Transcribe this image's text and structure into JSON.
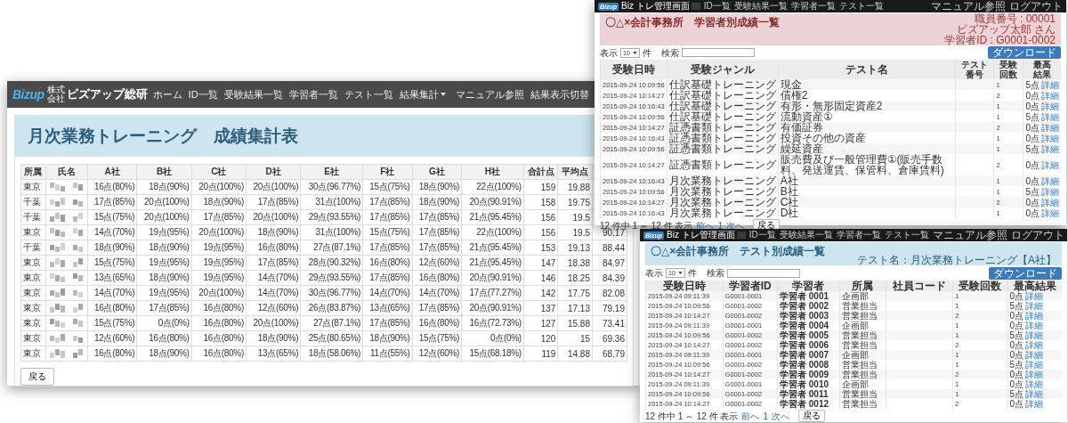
{
  "main_window": {
    "logo": "Bizup",
    "company_prefix": "株式会社",
    "company": "ビズアップ総研",
    "nav": [
      {
        "label": "ホーム",
        "dropdown": false
      },
      {
        "label": "ID一覧",
        "dropdown": false
      },
      {
        "label": "受験結果一覧",
        "dropdown": false
      },
      {
        "label": "学習者一覧",
        "dropdown": false
      },
      {
        "label": "テスト一覧",
        "dropdown": false
      },
      {
        "label": "結果集計",
        "dropdown": true
      }
    ],
    "nav_right": [
      "マニュアル参照",
      "結果表示切替"
    ],
    "title": "月次業務トレーニング　成績集計表",
    "table": {
      "columns": [
        "所属",
        "氏名",
        "A社",
        "B社",
        "C社",
        "D社",
        "E社",
        "F社",
        "G社",
        "H社",
        "合計点",
        "平均点"
      ],
      "rows": [
        {
          "dept": "東京",
          "scores": [
            "16点(80%)",
            "18点(90%)",
            "20点(100%)",
            "20点(100%)",
            "30点(96.77%)",
            "15点(75%)",
            "18点(90%)",
            "22点(100%)"
          ],
          "total": "159",
          "average": "19.88"
        },
        {
          "dept": "千葉",
          "scores": [
            "17点(85%)",
            "20点(100%)",
            "18点(90%)",
            "17点(85%)",
            "31点(100%)",
            "17点(85%)",
            "18点(90%)",
            "20点(90.91%)"
          ],
          "total": "158",
          "average": "19.75"
        },
        {
          "dept": "千葉",
          "scores": [
            "15点(75%)",
            "20点(100%)",
            "17点(85%)",
            "20点(100%)",
            "29点(93.55%)",
            "17点(85%)",
            "17点(85%)",
            "21点(95.45%)"
          ],
          "total": "156",
          "average": "19.5"
        },
        {
          "dept": "東京",
          "scores": [
            "14点(70%)",
            "19点(95%)",
            "20点(100%)",
            "18点(90%)",
            "31点(100%)",
            "15点(75%)",
            "17点(85%)",
            "22点(100%)"
          ],
          "total": "156",
          "average": "19.5",
          "rate": "90.17"
        },
        {
          "dept": "千葉",
          "scores": [
            "18点(90%)",
            "18点(90%)",
            "19点(95%)",
            "16点(80%)",
            "27点(87.1%)",
            "17点(85%)",
            "17点(85%)",
            "21点(95.45%)"
          ],
          "total": "153",
          "average": "19.13",
          "rate": "88.44"
        },
        {
          "dept": "東京",
          "scores": [
            "15点(75%)",
            "19点(95%)",
            "19点(95%)",
            "17点(85%)",
            "28点(90.32%)",
            "16点(80%)",
            "12点(60%)",
            "21点(95.45%)"
          ],
          "total": "147",
          "average": "18.38",
          "rate": "84.97"
        },
        {
          "dept": "東京",
          "scores": [
            "13点(65%)",
            "18点(90%)",
            "19点(95%)",
            "14点(70%)",
            "29点(93.55%)",
            "17点(85%)",
            "16点(80%)",
            "20点(90.91%)"
          ],
          "total": "146",
          "average": "18.25",
          "rate": "84.39"
        },
        {
          "dept": "東京",
          "scores": [
            "14点(70%)",
            "19点(95%)",
            "20点(100%)",
            "14点(70%)",
            "30点(96.77%)",
            "14点(70%)",
            "14点(70%)",
            "17点(77.27%)"
          ],
          "total": "142",
          "average": "17.75",
          "rate": "82.08"
        },
        {
          "dept": "東京",
          "scores": [
            "16点(80%)",
            "17点(85%)",
            "16点(80%)",
            "12点(60%)",
            "26点(83.87%)",
            "13点(65%)",
            "17点(85%)",
            "20点(90.91%)"
          ],
          "total": "137",
          "average": "17.13",
          "rate": "79.19"
        },
        {
          "dept": "東京",
          "scores": [
            "15点(75%)",
            "0点(0%)",
            "16点(80%)",
            "20点(100%)",
            "27点(87.1%)",
            "17点(85%)",
            "16点(80%)",
            "16点(72.73%)"
          ],
          "total": "127",
          "average": "15.88",
          "rate": "73.41"
        },
        {
          "dept": "東京",
          "scores": [
            "12点(60%)",
            "16点(80%)",
            "16点(80%)",
            "18点(90%)",
            "25点(80.65%)",
            "18点(90%)",
            "15点(75%)",
            "0点(0%)"
          ],
          "total": "120",
          "average": "15",
          "rate": "69.36"
        },
        {
          "dept": "東京",
          "scores": [
            "16点(80%)",
            "18点(90%)",
            "16点(80%)",
            "13点(65%)",
            "18点(58.06%)",
            "11点(55%)",
            "12点(60%)",
            "15点(68.18%)"
          ],
          "total": "119",
          "average": "14.88",
          "rate": "68.79"
        }
      ]
    },
    "back_button": "戻る"
  },
  "learner_window": {
    "logo": "Bizup",
    "app_title": "Biz トレ管理画面",
    "nav": [
      "ID一覧",
      "受験結果一覧",
      "学習者一覧",
      "テスト一覧"
    ],
    "nav_right": [
      "マニュアル参照",
      "ログアウト"
    ],
    "title": "〇△×会計事務所　学習者別成績一覧",
    "info": [
      "職員番号 : 00001",
      "ビズアップ太郎 さん",
      "学習者ID : G0001-0002"
    ],
    "download_button": "ダウンロード",
    "length_label": "表示",
    "length_value": "10",
    "length_unit": "件",
    "search_label": "検索",
    "columns": [
      "受験日時",
      "受験ジャンル",
      "テスト名",
      "テスト番号",
      "受験回数",
      "最高結果"
    ],
    "rows": [
      {
        "date": "2015-09-24 10:09:56",
        "genre": "仕訳基礎トレーニング",
        "test": "現金",
        "attempts": "1",
        "score": "5点",
        "link": "詳細"
      },
      {
        "date": "2015-09-24 10:14:27",
        "genre": "仕訳基礎トレーニング",
        "test": "債権2",
        "attempts": "2",
        "score": "0点",
        "link": "詳細"
      },
      {
        "date": "2015-09-24 10:16:43",
        "genre": "仕訳基礎トレーニング",
        "test": "有形・無形固定資産2",
        "attempts": "1",
        "score": "0点",
        "link": "詳細"
      },
      {
        "date": "2015-09-24 10:09:56",
        "genre": "仕訳基礎トレーニング",
        "test": "流動資産①",
        "attempts": "1",
        "score": "5点",
        "link": "詳細"
      },
      {
        "date": "2015-09-24 10:14:27",
        "genre": "証憑書類トレーニング",
        "test": "有価証券",
        "attempts": "2",
        "score": "0点",
        "link": "詳細"
      },
      {
        "date": "2015-09-24 10:16:43",
        "genre": "証憑書類トレーニング",
        "test": "投資その他の資産",
        "attempts": "1",
        "score": "0点",
        "link": "詳細"
      },
      {
        "date": "2015-09-24 10:09:56",
        "genre": "証憑書類トレーニング",
        "test": "繰延資産",
        "attempts": "1",
        "score": "5点",
        "link": "詳細"
      },
      {
        "date": "2015-09-24 10:14:27",
        "genre": "証憑書類トレーニング",
        "test": "販売費及び一般管理費①(販売手数料、発送運賃、保管料、倉庫賃料)",
        "attempts": "2",
        "score": "0点",
        "link": "詳細"
      },
      {
        "date": "2015-09-24 10:16:43",
        "genre": "月次業務トレーニング",
        "test": "A社",
        "attempts": "1",
        "score": "0点",
        "link": "詳細"
      },
      {
        "date": "2015-09-24 10:09:56",
        "genre": "月次業務トレーニング",
        "test": "B社",
        "attempts": "1",
        "score": "5点",
        "link": "詳細"
      },
      {
        "date": "2015-09-24 10:14:27",
        "genre": "月次業務トレーニング",
        "test": "C社",
        "attempts": "2",
        "score": "0点",
        "link": "詳細"
      },
      {
        "date": "2015-09-24 10:16:43",
        "genre": "月次業務トレーニング",
        "test": "D社",
        "attempts": "1",
        "score": "0点",
        "link": "詳細"
      }
    ],
    "summary": "12 件中 1 ～ 12 件 表示",
    "pager": [
      "前へ",
      "1",
      "次へ"
    ],
    "back_button": "戻る"
  },
  "test_window": {
    "logo": "Bizup",
    "app_title": "Biz トレ管理画面",
    "nav": [
      "ID一覧",
      "受験結果一覧",
      "学習者一覧",
      "テスト一覧"
    ],
    "nav_right": [
      "マニュアル参照",
      "ログアウト"
    ],
    "title": "〇△×会計事務所　テスト別成績一覧",
    "subtitle": "テスト名：月次業務トレーニング【A社】",
    "download_button": "ダウンロード",
    "length_label": "表示",
    "length_value": "10",
    "length_unit": "件",
    "search_label": "検索",
    "columns": [
      "受験日時",
      "学習者ID",
      "学習者",
      "所属",
      "社員コード",
      "受験回数",
      "最高結果"
    ],
    "rows": [
      {
        "date": "2015-09-24 09:11:39",
        "id": "G0001-0001",
        "learner": "学習者 0001",
        "dept": "企画部",
        "attempts": "1",
        "score": "0点",
        "link": "詳細"
      },
      {
        "date": "2015-09-24 10:09:56",
        "id": "G0001-0002",
        "learner": "学習者 0002",
        "dept": "営業担当",
        "attempts": "1",
        "score": "5点",
        "link": "詳細"
      },
      {
        "date": "2015-09-24 10:14:27",
        "id": "G0001-0002",
        "learner": "学習者 0003",
        "dept": "営業担当",
        "attempts": "2",
        "score": "0点",
        "link": "詳細"
      },
      {
        "date": "2015-09-24 09:11:39",
        "id": "G0001-0001",
        "learner": "学習者 0004",
        "dept": "企画部",
        "attempts": "1",
        "score": "0点",
        "link": "詳細"
      },
      {
        "date": "2015-09-24 10:09:56",
        "id": "G0001-0002",
        "learner": "学習者 0005",
        "dept": "営業担当",
        "attempts": "1",
        "score": "5点",
        "link": "詳細"
      },
      {
        "date": "2015-09-24 10:14:27",
        "id": "G0001-0002",
        "learner": "学習者 0006",
        "dept": "営業担当",
        "attempts": "2",
        "score": "0点",
        "link": "詳細"
      },
      {
        "date": "2015-09-24 09:11:39",
        "id": "G0001-0001",
        "learner": "学習者 0007",
        "dept": "企画部",
        "attempts": "1",
        "score": "0点",
        "link": "詳細"
      },
      {
        "date": "2015-09-24 10:09:56",
        "id": "G0001-0002",
        "learner": "学習者 0008",
        "dept": "営業担当",
        "attempts": "1",
        "score": "5点",
        "link": "詳細"
      },
      {
        "date": "2015-09-24 10:14:27",
        "id": "G0001-0002",
        "learner": "学習者 0009",
        "dept": "営業担当",
        "attempts": "2",
        "score": "0点",
        "link": "詳細"
      },
      {
        "date": "2015-09-24 09:11:39",
        "id": "G0001-0001",
        "learner": "学習者 0010",
        "dept": "企画部",
        "attempts": "1",
        "score": "0点",
        "link": "詳細"
      },
      {
        "date": "2015-09-24 10:09:56",
        "id": "G0001-0002",
        "learner": "学習者 0011",
        "dept": "営業担当",
        "attempts": "1",
        "score": "5点",
        "link": "詳細"
      },
      {
        "date": "2015-09-24 10:14:27",
        "id": "G0001-0002",
        "learner": "学習者 0012",
        "dept": "営業担当",
        "attempts": "2",
        "score": "0点",
        "link": "詳細"
      }
    ],
    "summary": "12 件中 1 ～ 12 件 表示",
    "pager": [
      "前へ",
      "1",
      "次へ"
    ],
    "back_button": "戻る"
  }
}
